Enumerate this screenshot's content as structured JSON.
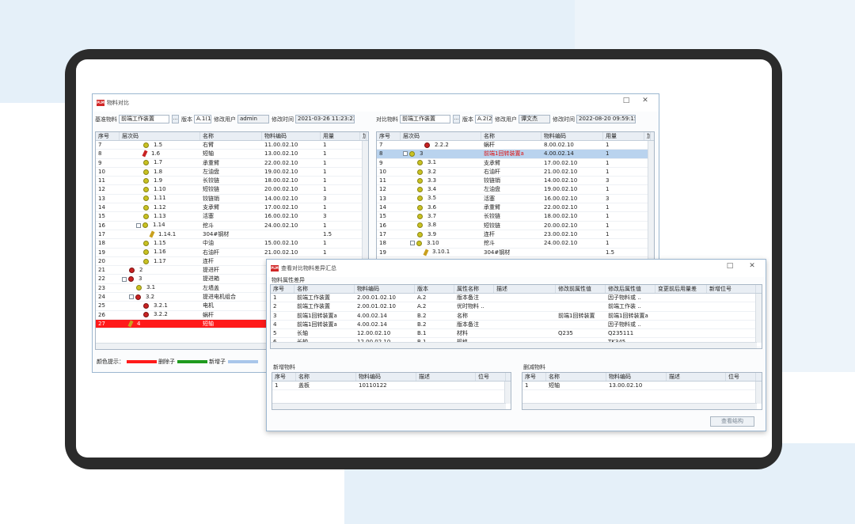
{
  "colors": {
    "deleted": "#ff1a1a",
    "added": "#1e9a1e",
    "modified": "#a9c6ea",
    "selected": "#b9d3ee",
    "accent": "#d12626"
  },
  "win1": {
    "title": "物料对比",
    "left": {
      "base_label": "基准物料",
      "base_value": "前端工作装置",
      "version_label": "版本",
      "version_value": "A.1(1",
      "user_label": "修改用户",
      "user_value": "admin",
      "time_label": "修改时间",
      "time_value": "2021-03-26 11:23:22"
    },
    "right": {
      "base_label": "对比物料",
      "base_value": "前端工作装置",
      "version_label": "版本",
      "version_value": "A.2(2",
      "user_label": "修改用户",
      "user_value": "谭文杰",
      "time_label": "修改时间",
      "time_value": "2022-08-20 09:59:15"
    },
    "headers_left": [
      "序号",
      "层次码",
      "名称",
      "物料编码",
      "用量",
      "加"
    ],
    "headers_right": [
      "序号",
      "层次码",
      "名称",
      "物料编码",
      "用量",
      "加"
    ],
    "rows_left": [
      {
        "seq": "7",
        "code": "1.5",
        "name": "右臂",
        "mat": "11.00.02.10",
        "qty": "1",
        "icon": "gear",
        "indent": 3,
        "state": ""
      },
      {
        "seq": "8",
        "code": "1.6",
        "name": "短轴",
        "mat": "13.00.02.10",
        "qty": "1",
        "icon": "pin-red",
        "indent": 3,
        "state": ""
      },
      {
        "seq": "9",
        "code": "1.7",
        "name": "承重臂",
        "mat": "22.00.02.10",
        "qty": "1",
        "icon": "gear",
        "indent": 3,
        "state": ""
      },
      {
        "seq": "10",
        "code": "1.8",
        "name": "左油盘",
        "mat": "19.00.02.10",
        "qty": "1",
        "icon": "gear",
        "indent": 3,
        "state": ""
      },
      {
        "seq": "11",
        "code": "1.9",
        "name": "长铰链",
        "mat": "18.00.02.10",
        "qty": "1",
        "icon": "gear",
        "indent": 3,
        "state": ""
      },
      {
        "seq": "12",
        "code": "1.10",
        "name": "短铰链",
        "mat": "20.00.02.10",
        "qty": "1",
        "icon": "gear",
        "indent": 3,
        "state": ""
      },
      {
        "seq": "13",
        "code": "1.11",
        "name": "铰链销",
        "mat": "14.00.02.10",
        "qty": "3",
        "icon": "gear",
        "indent": 3,
        "state": ""
      },
      {
        "seq": "14",
        "code": "1.12",
        "name": "支承臂",
        "mat": "17.00.02.10",
        "qty": "1",
        "icon": "gear",
        "indent": 3,
        "state": ""
      },
      {
        "seq": "15",
        "code": "1.13",
        "name": "活塞",
        "mat": "16.00.02.10",
        "qty": "3",
        "icon": "gear",
        "indent": 3,
        "state": ""
      },
      {
        "seq": "16",
        "code": "1.14",
        "name": "挖斗",
        "mat": "24.00.02.10",
        "qty": "1",
        "icon": "gear",
        "indent": 2,
        "toggle": "−",
        "state": ""
      },
      {
        "seq": "17",
        "code": "1.14.1",
        "name": "304#钢材",
        "mat": "",
        "qty": "1.5",
        "icon": "pin",
        "indent": 4,
        "state": ""
      },
      {
        "seq": "18",
        "code": "1.15",
        "name": "中油",
        "mat": "15.00.02.10",
        "qty": "1",
        "icon": "gear",
        "indent": 3,
        "state": ""
      },
      {
        "seq": "19",
        "code": "1.16",
        "name": "右油杆",
        "mat": "21.00.02.10",
        "qty": "1",
        "icon": "gear",
        "indent": 3,
        "state": ""
      },
      {
        "seq": "20",
        "code": "1.17",
        "name": "连杆",
        "mat": "",
        "qty": "",
        "icon": "gear",
        "indent": 3,
        "state": ""
      },
      {
        "seq": "21",
        "code": "2",
        "name": "提进杆",
        "mat": "",
        "qty": "9",
        "icon": "gear-red",
        "indent": 1,
        "state": ""
      },
      {
        "seq": "22",
        "code": "3",
        "name": "提进箱",
        "mat": "",
        "qty": "4",
        "icon": "gear-red",
        "indent": 0,
        "toggle": "−",
        "state": ""
      },
      {
        "seq": "23",
        "code": "3.1",
        "name": "左墙盖",
        "mat": "",
        "qty": "5",
        "icon": "gear",
        "indent": 2,
        "state": ""
      },
      {
        "seq": "24",
        "code": "3.2",
        "name": "提进电机组合",
        "mat": "",
        "qty": "4",
        "icon": "gear-red",
        "indent": 1,
        "toggle": "−",
        "state": ""
      },
      {
        "seq": "25",
        "code": "3.2.1",
        "name": "电机",
        "mat": "",
        "qty": "",
        "icon": "gear-red",
        "indent": 3,
        "state": ""
      },
      {
        "seq": "26",
        "code": "3.2.2",
        "name": "蜗杆",
        "mat": "",
        "qty": "",
        "icon": "gear-red",
        "indent": 3,
        "state": ""
      },
      {
        "seq": "27",
        "code": "4",
        "name": "短轴",
        "mat": "",
        "qty": "",
        "icon": "pin",
        "indent": 1,
        "state": "del"
      }
    ],
    "rows_right": [
      {
        "seq": "7",
        "code": "2.2.2",
        "name": "蜗杆",
        "mat": "8.00.02.10",
        "qty": "1",
        "icon": "gear-red",
        "indent": 3,
        "state": ""
      },
      {
        "seq": "8",
        "code": "3",
        "name": "前端1回转装置a",
        "mat": "4.00.02.14",
        "qty": "1",
        "icon": "gear",
        "indent": 0,
        "toggle": "−",
        "state": "sel"
      },
      {
        "seq": "9",
        "code": "3.1",
        "name": "支承臂",
        "mat": "17.00.02.10",
        "qty": "1",
        "icon": "gear",
        "indent": 2,
        "state": ""
      },
      {
        "seq": "10",
        "code": "3.2",
        "name": "右油杆",
        "mat": "21.00.02.10",
        "qty": "1",
        "icon": "gear",
        "indent": 2,
        "state": ""
      },
      {
        "seq": "11",
        "code": "3.3",
        "name": "铰链销",
        "mat": "14.00.02.10",
        "qty": "3",
        "icon": "gear",
        "indent": 2,
        "state": ""
      },
      {
        "seq": "12",
        "code": "3.4",
        "name": "左油盘",
        "mat": "19.00.02.10",
        "qty": "1",
        "icon": "gear",
        "indent": 2,
        "state": ""
      },
      {
        "seq": "13",
        "code": "3.5",
        "name": "活塞",
        "mat": "16.00.02.10",
        "qty": "3",
        "icon": "gear",
        "indent": 2,
        "state": ""
      },
      {
        "seq": "14",
        "code": "3.6",
        "name": "承重臂",
        "mat": "22.00.02.10",
        "qty": "1",
        "icon": "gear",
        "indent": 2,
        "state": ""
      },
      {
        "seq": "15",
        "code": "3.7",
        "name": "长铰链",
        "mat": "18.00.02.10",
        "qty": "1",
        "icon": "gear",
        "indent": 2,
        "state": ""
      },
      {
        "seq": "16",
        "code": "3.8",
        "name": "短铰链",
        "mat": "20.00.02.10",
        "qty": "1",
        "icon": "gear",
        "indent": 2,
        "state": ""
      },
      {
        "seq": "17",
        "code": "3.9",
        "name": "连杆",
        "mat": "23.00.02.10",
        "qty": "1",
        "icon": "gear",
        "indent": 2,
        "state": ""
      },
      {
        "seq": "18",
        "code": "3.10",
        "name": "挖斗",
        "mat": "24.00.02.10",
        "qty": "1",
        "icon": "gear",
        "indent": 1,
        "toggle": "−",
        "state": ""
      },
      {
        "seq": "19",
        "code": "3.10.1",
        "name": "304#钢材",
        "mat": "",
        "qty": "1.5",
        "icon": "pin",
        "indent": 3,
        "state": ""
      }
    ],
    "legend": {
      "label": "颜色提示：",
      "deleted": "删除子",
      "added": "新增子"
    }
  },
  "win2": {
    "title": "查看对比物料差异汇总",
    "attr_section": "物料属性差异",
    "attr_headers": [
      "序号",
      "名称",
      "物料编码",
      "版本",
      "属性名称",
      "描述",
      "修改前属性值",
      "修改后属性值",
      "变更前后用量差",
      "新增位号"
    ],
    "attr_rows": [
      [
        "1",
        "前端工作装置",
        "2.00.01.02.10",
        "A.2",
        "版本备注",
        "",
        "",
        "因子物料或 ..",
        "",
        ""
      ],
      [
        "2",
        "前端工作装置",
        "2.00.01.02.10",
        "A.2",
        "优时物料 ..",
        "",
        "",
        "前端工作装 ..",
        "",
        ""
      ],
      [
        "3",
        "前端1回转装置a",
        "4.00.02.14",
        "B.2",
        "名称",
        "",
        "前端1回转装置",
        "前端1回转装置a",
        "",
        ""
      ],
      [
        "4",
        "前端1回转装置a",
        "4.00.02.14",
        "B.2",
        "版本备注",
        "",
        "",
        "因子物料或 ..",
        "",
        ""
      ],
      [
        "5",
        "长轴",
        "12.00.02.10",
        "B.1",
        "材料",
        "",
        "Q235",
        "Q235111",
        "",
        ""
      ],
      [
        "6",
        "长轴",
        "12.00.02.10",
        "B.1",
        "规格",
        "",
        "",
        "TK345",
        "",
        ""
      ]
    ],
    "added_section": "新增物料",
    "added_headers": [
      "序号",
      "名称",
      "物料编码",
      "描述",
      "位号"
    ],
    "added_rows": [
      [
        "1",
        "盖板",
        "10110122",
        "",
        ""
      ]
    ],
    "deleted_section": "删减物料",
    "deleted_headers": [
      "序号",
      "名称",
      "物料编码",
      "描述",
      "位号"
    ],
    "deleted_rows": [
      [
        "1",
        "短轴",
        "13.00.02.10",
        "",
        ""
      ]
    ],
    "view_button": "查看结构"
  }
}
